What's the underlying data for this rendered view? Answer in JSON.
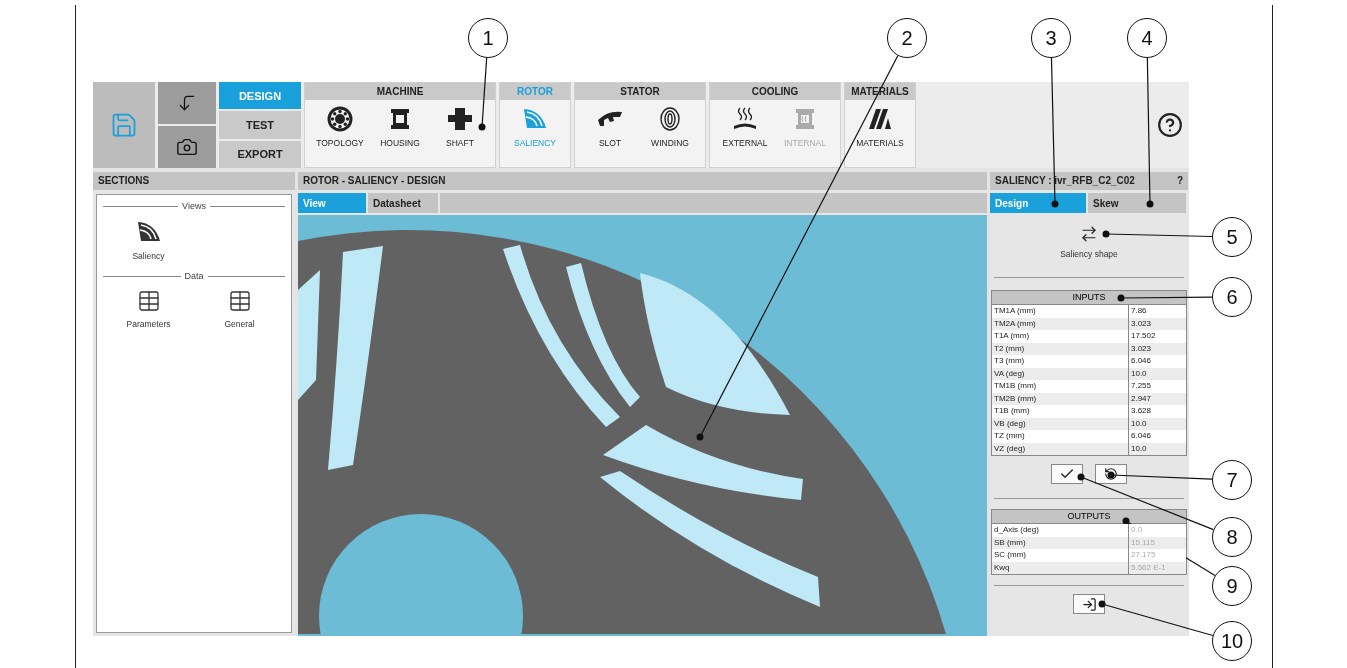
{
  "toolbar": {
    "mode_tabs": [
      {
        "label": "DESIGN",
        "selected": true
      },
      {
        "label": "TEST",
        "selected": false
      },
      {
        "label": "EXPORT",
        "selected": false
      }
    ],
    "groups": [
      {
        "title": "MACHINE",
        "active": false,
        "items": [
          {
            "label": "TOPOLOGY",
            "selected": false,
            "disabled": false
          },
          {
            "label": "HOUSING",
            "selected": false,
            "disabled": false
          },
          {
            "label": "SHAFT",
            "selected": false,
            "disabled": false
          }
        ]
      },
      {
        "title": "ROTOR",
        "active": true,
        "items": [
          {
            "label": "SALIENCY",
            "selected": true,
            "disabled": false
          }
        ]
      },
      {
        "title": "STATOR",
        "active": false,
        "items": [
          {
            "label": "SLOT",
            "selected": false,
            "disabled": false
          },
          {
            "label": "WINDING",
            "selected": false,
            "disabled": false
          }
        ]
      },
      {
        "title": "COOLING",
        "active": false,
        "items": [
          {
            "label": "EXTERNAL",
            "selected": false,
            "disabled": false
          },
          {
            "label": "INTERNAL",
            "selected": false,
            "disabled": true
          }
        ]
      },
      {
        "title": "MATERIALS",
        "active": false,
        "items": [
          {
            "label": "MATERIALS",
            "selected": false,
            "disabled": false
          }
        ]
      }
    ]
  },
  "sections": {
    "title": "SECTIONS",
    "groups": [
      {
        "title": "Views",
        "items": [
          {
            "label": "Saliency"
          }
        ]
      },
      {
        "title": "Data",
        "items": [
          {
            "label": "Parameters"
          },
          {
            "label": "General"
          }
        ]
      }
    ]
  },
  "main": {
    "title": "ROTOR - SALIENCY - DESIGN",
    "tabs": [
      {
        "label": "View",
        "selected": true
      },
      {
        "label": "Datasheet",
        "selected": false
      }
    ]
  },
  "right_panel": {
    "title": "SALIENCY : ivr_RFB_C2_C02",
    "help": "?",
    "tabs": [
      {
        "label": "Design",
        "selected": true
      },
      {
        "label": "Skew",
        "selected": false
      }
    ],
    "shape_label": "Saliency shape",
    "inputs": {
      "title": "INPUTS",
      "rows": [
        {
          "name": "TM1A (mm)",
          "value": "7.86"
        },
        {
          "name": "TM2A (mm)",
          "value": "3.023"
        },
        {
          "name": "T1A (mm)",
          "value": "17.502"
        },
        {
          "name": "T2 (mm)",
          "value": "3.023"
        },
        {
          "name": "T3 (mm)",
          "value": "6.046"
        },
        {
          "name": "VA (deg)",
          "value": "10.0"
        },
        {
          "name": "TM1B (mm)",
          "value": "7.255"
        },
        {
          "name": "TM2B (mm)",
          "value": "2.947"
        },
        {
          "name": "T1B (mm)",
          "value": "3.628"
        },
        {
          "name": "VB (deg)",
          "value": "10.0"
        },
        {
          "name": "TZ (mm)",
          "value": "6.046"
        },
        {
          "name": "VZ (deg)",
          "value": "10.0"
        }
      ]
    },
    "outputs": {
      "title": "OUTPUTS",
      "rows": [
        {
          "name": "d_Axis (deg)",
          "value": "0.0"
        },
        {
          "name": "SB (mm)",
          "value": "15.115"
        },
        {
          "name": "SC (mm)",
          "value": "27.175"
        },
        {
          "name": "Kwq",
          "value": "5.562 E-1"
        }
      ]
    }
  },
  "callouts": [
    "1",
    "2",
    "3",
    "4",
    "5",
    "6",
    "7",
    "8",
    "9",
    "10"
  ]
}
